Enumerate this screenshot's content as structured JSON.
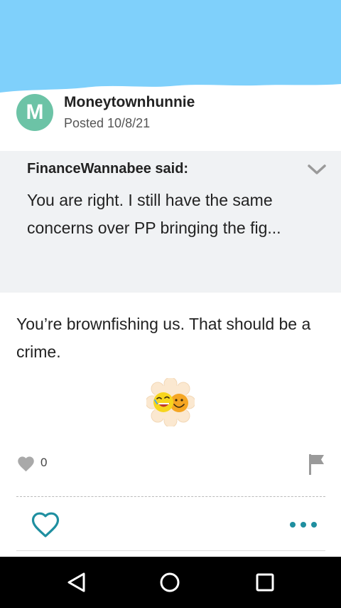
{
  "colors": {
    "sky": "#7fd0fb",
    "avatar_bg": "#6cc3a6",
    "accent": "#1f8fa0",
    "quote_bg": "#f0f2f4",
    "nav_bg": "#000000"
  },
  "post": {
    "avatar_initial": "M",
    "author": "Moneytownhunnie",
    "date": "Posted 10/8/21",
    "body": "You’re brownfishing us. That should be a crime."
  },
  "quote": {
    "author": "FinanceWannabee said:",
    "text": "You are right. I still have the same concerns over PP bringing the fig..."
  },
  "reactions": {
    "like_count": "0"
  },
  "icons": {
    "sticker": "laughing-and-smiling-faces-sticker",
    "like": "heart-filled-icon",
    "flag": "flag-icon",
    "heart_button": "heart-outline-icon",
    "more": "more-dots-icon",
    "chevron": "chevron-down-icon",
    "nav_back": "back-triangle-icon",
    "nav_home": "home-circle-icon",
    "nav_recents": "recents-square-icon"
  }
}
